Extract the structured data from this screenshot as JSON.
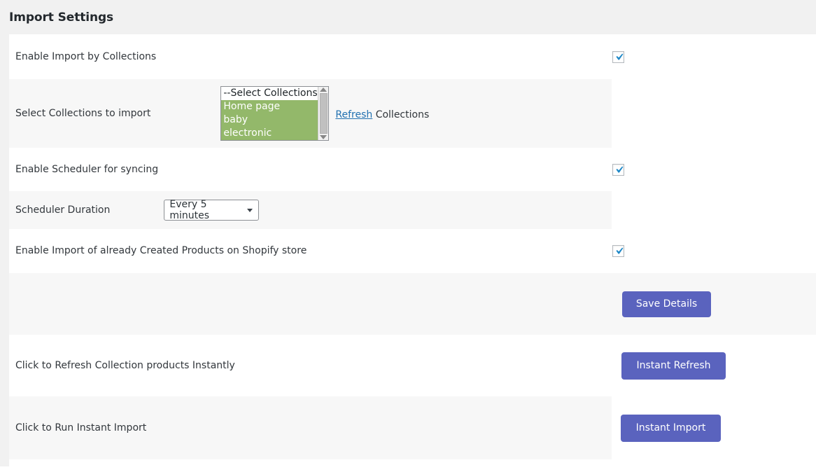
{
  "header": {
    "title": "Import Settings"
  },
  "colors": {
    "accent_button": "#5a63be",
    "link": "#2271b1",
    "selection_green": "#93b86a",
    "checkbox_check": "#1e88c7",
    "page_background": "#f1f1f1",
    "row_stripe": "#f7f7f7"
  },
  "rows": {
    "enable_collections": {
      "label": "Enable Import by Collections",
      "checkbox_checked": true
    },
    "select_collections": {
      "label": "Select Collections to import",
      "listbox": {
        "options": [
          {
            "label": "--Select Collections--",
            "selected": false
          },
          {
            "label": "Home page",
            "selected": true
          },
          {
            "label": "baby",
            "selected": true
          },
          {
            "label": "electronic",
            "selected": true
          }
        ]
      },
      "refresh_link": "Refresh",
      "refresh_suffix": " Collections"
    },
    "enable_scheduler": {
      "label": "Enable Scheduler for syncing",
      "checkbox_checked": true
    },
    "scheduler_duration": {
      "label": "Scheduler Duration",
      "select_value": "Every 5 minutes"
    },
    "enable_created_products": {
      "label": "Enable Import of already Created Products on Shopify store",
      "checkbox_checked": true
    },
    "save": {
      "button_label": "Save Details"
    },
    "refresh_products": {
      "label": "Click to Refresh Collection products Instantly",
      "button_label": "Instant Refresh"
    },
    "run_import": {
      "label": "Click to Run Instant Import",
      "button_label": "Instant Import"
    }
  }
}
